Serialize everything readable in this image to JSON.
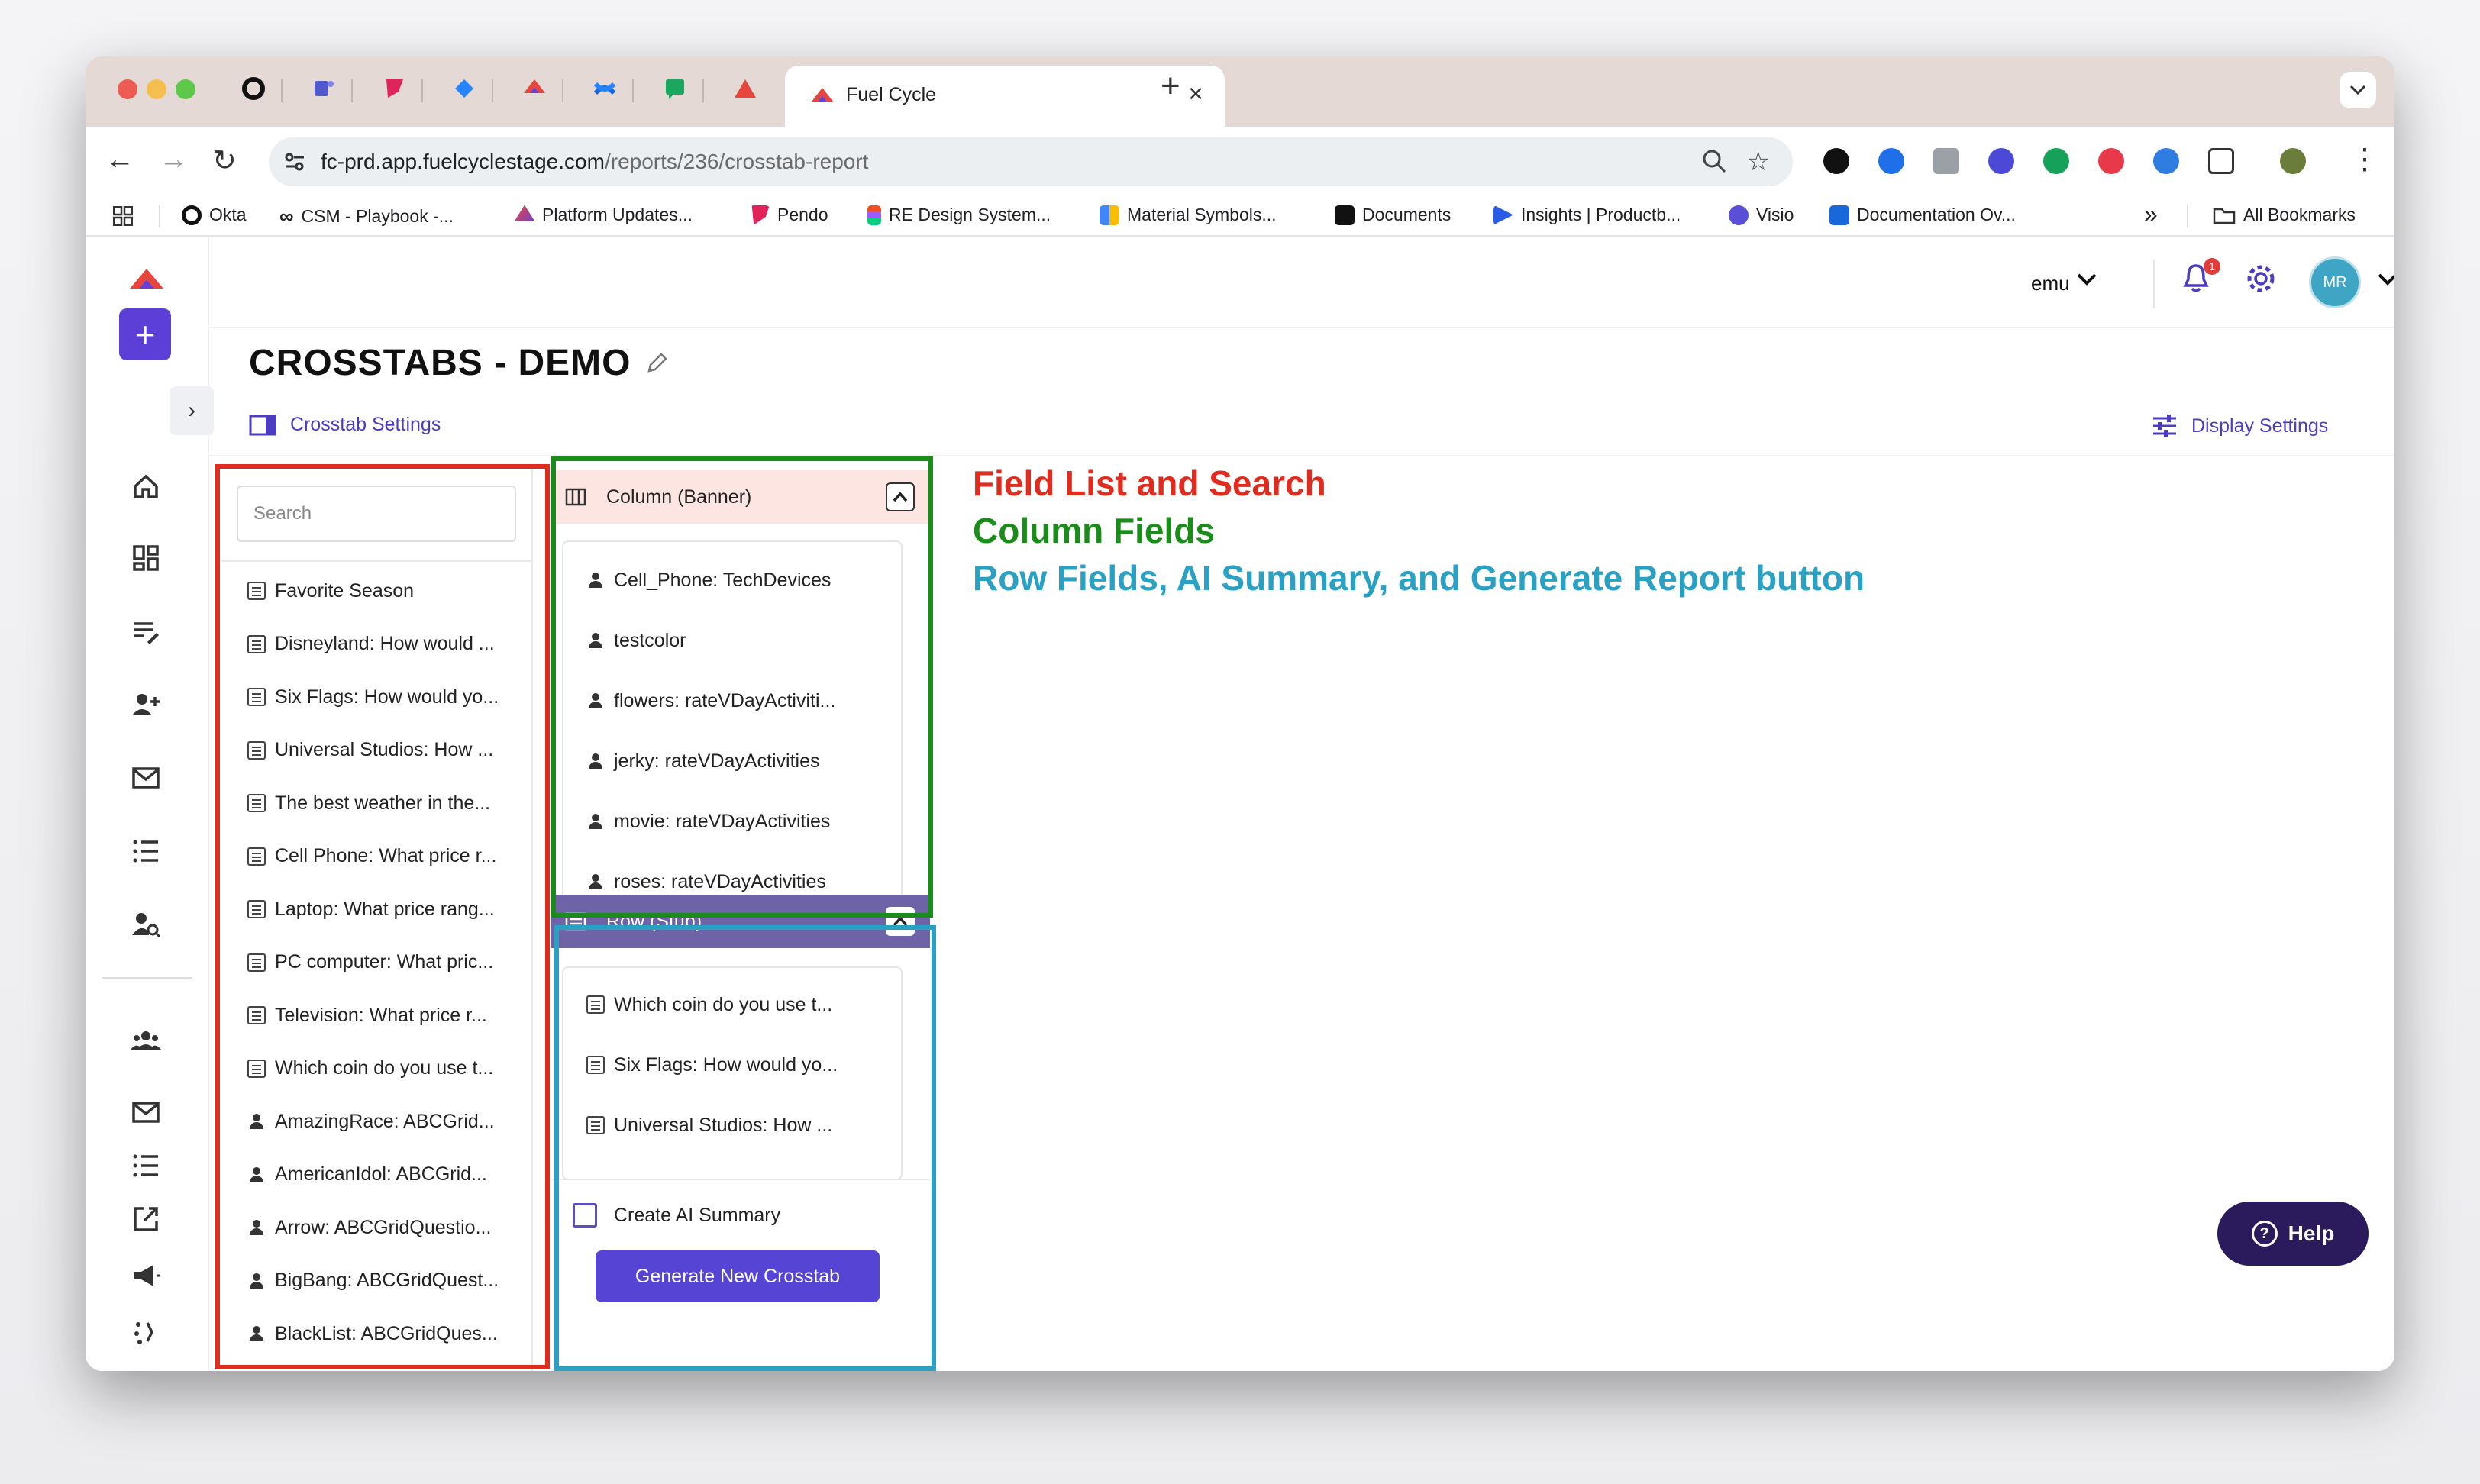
{
  "browser": {
    "active_tab_title": "Fuel Cycle",
    "url_host": "fc-prd.app.fuelcyclestage.com",
    "url_path": "/reports/236/crosstab-report",
    "bookmarks": [
      "Okta",
      "CSM - Playbook -...",
      "Platform Updates...",
      "Pendo",
      "RE Design System...",
      "Material Symbols...",
      "Documents",
      "Insights | Productb...",
      "Visio",
      "Documentation Ov..."
    ],
    "all_bookmarks": "All Bookmarks",
    "overflow": "»"
  },
  "header": {
    "user": "emu",
    "notification_count": "1",
    "avatar_initials": "MR"
  },
  "page": {
    "title": "CROSSTABS - DEMO",
    "crosstab_settings": "Crosstab Settings",
    "display_settings": "Display Settings"
  },
  "field_list": {
    "search_placeholder": "Search",
    "items": [
      {
        "label": "Favorite Season",
        "kind": "table"
      },
      {
        "label": "Disneyland: How would ...",
        "kind": "table"
      },
      {
        "label": "Six Flags: How would yo...",
        "kind": "table"
      },
      {
        "label": "Universal Studios: How ...",
        "kind": "table"
      },
      {
        "label": "The best weather in the...",
        "kind": "table"
      },
      {
        "label": "Cell Phone: What price r...",
        "kind": "table"
      },
      {
        "label": "Laptop: What price rang...",
        "kind": "table"
      },
      {
        "label": "PC computer: What pric...",
        "kind": "table"
      },
      {
        "label": "Television: What price r...",
        "kind": "table"
      },
      {
        "label": "Which coin do you use t...",
        "kind": "table"
      },
      {
        "label": "AmazingRace: ABCGrid...",
        "kind": "person"
      },
      {
        "label": "AmericanIdol: ABCGrid...",
        "kind": "person"
      },
      {
        "label": "Arrow: ABCGridQuestio...",
        "kind": "person"
      },
      {
        "label": "BigBang: ABCGridQuest...",
        "kind": "person"
      },
      {
        "label": "BlackList: ABCGridQues...",
        "kind": "person"
      }
    ]
  },
  "column_panel": {
    "title": "Column (Banner)",
    "items": [
      "Cell_Phone: TechDevices",
      "testcolor",
      "flowers: rateVDayActiviti...",
      "jerky: rateVDayActivities",
      "movie: rateVDayActivities",
      "roses: rateVDayActivities"
    ]
  },
  "row_panel": {
    "title": "Row (Stub)",
    "items": [
      "Which coin do you use t...",
      "Six Flags: How would yo...",
      "Universal Studios: How ..."
    ],
    "ai_summary_label": "Create AI Summary",
    "generate_label": "Generate New Crosstab"
  },
  "annotations": {
    "field_list": "Field List and Search",
    "column_fields": "Column Fields",
    "row_fields": "Row Fields, AI Summary, and Generate Report button"
  },
  "help": {
    "label": "Help"
  },
  "colors": {
    "accent": "#5b3fd6",
    "annotation_red": "#e02b1f",
    "annotation_green": "#1a8c1a",
    "annotation_teal": "#2aa0c2"
  }
}
